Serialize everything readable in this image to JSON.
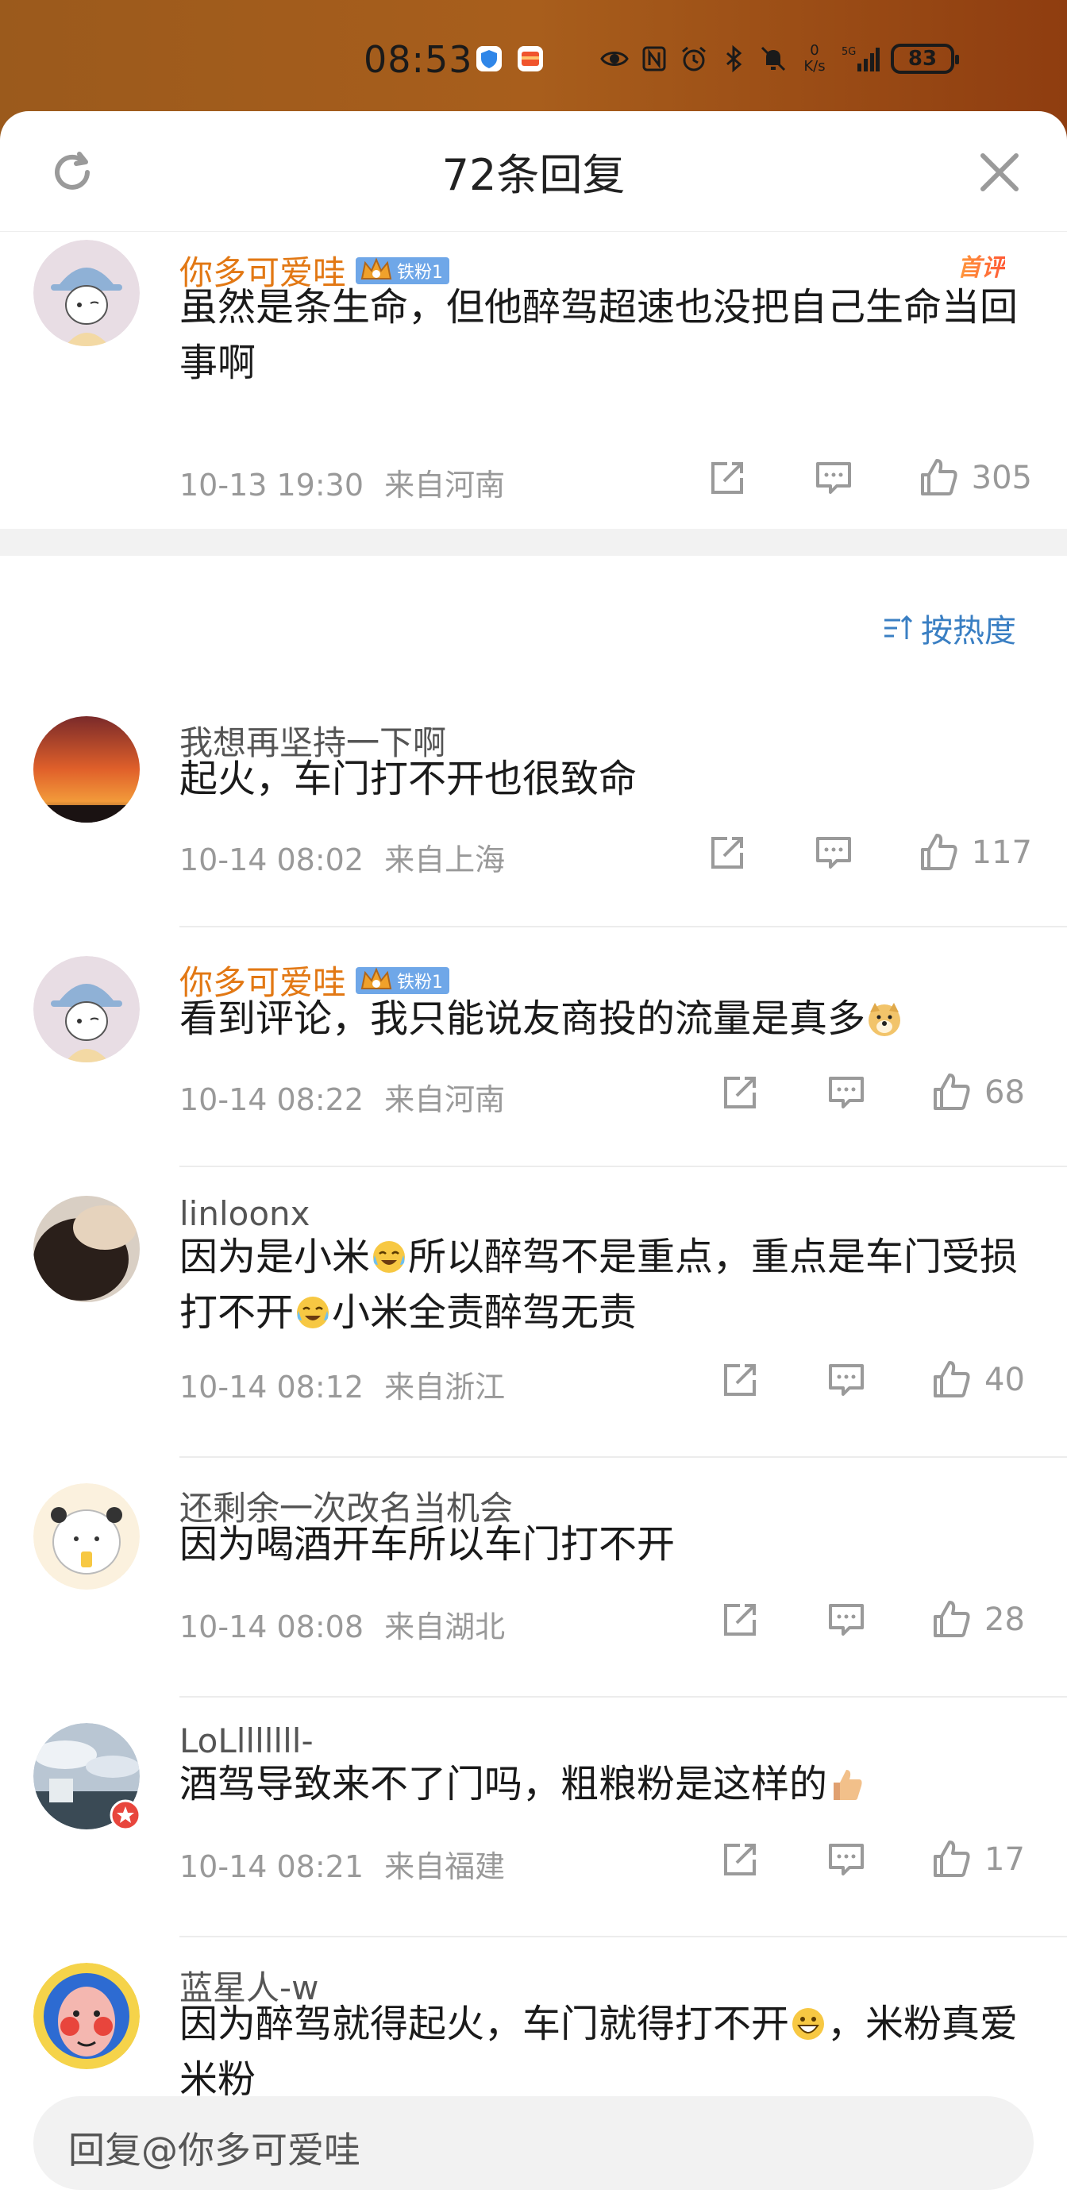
{
  "status_bar": {
    "time": "08:53",
    "net_speed": "0\nK/s",
    "network": "5G",
    "battery": "83"
  },
  "header": {
    "title": "72条回复"
  },
  "top_comment": {
    "user": "你多可爱哇",
    "fan_badge": "铁粉1",
    "hot_tag": "首评",
    "text": "虽然是条生命，但他醉驾超速也没把自己生命当回事啊",
    "time": "10-13 19:30",
    "location": "来自河南",
    "likes": "305"
  },
  "sort": {
    "label": "按热度"
  },
  "replies": [
    {
      "user": "我想再坚持一下啊",
      "text": "起火，车门打不开也很致命",
      "time": "10-14 08:02",
      "location": "来自上海",
      "likes": "117"
    },
    {
      "user": "你多可爱哇",
      "fan_badge": "铁粉1",
      "text": "看到评论，我只能说友商投的流量是真多",
      "time": "10-14 08:22",
      "location": "来自河南",
      "likes": "68"
    },
    {
      "user": "linloonx",
      "text_parts": [
        "因为是小米",
        "所以醉驾不是重点，重点是车门受损打不开",
        "小米全责醉驾无责"
      ],
      "time": "10-14 08:12",
      "location": "来自浙江",
      "likes": "40"
    },
    {
      "user": "还剩余一次改名当机会",
      "text": "因为喝酒开车所以车门打不开",
      "time": "10-14 08:08",
      "location": "来自湖北",
      "likes": "28"
    },
    {
      "user": "LoLlllllll-",
      "text": "酒驾导致来不了门吗，粗粮粉是这样的",
      "time": "10-14 08:21",
      "location": "来自福建",
      "likes": "17"
    },
    {
      "user": "蓝星人-w",
      "text_parts": [
        "因为醉驾就得起火，车门就得打不开",
        "，米粉真爱米粉"
      ]
    }
  ],
  "reply_bar": {
    "placeholder": "回复@你多可爱哇"
  },
  "colors": {
    "vip_name": "#e27814",
    "sort_blue": "#3a7fc3",
    "meta_gray": "#999999",
    "badge_blue": "#6fa7e8"
  }
}
